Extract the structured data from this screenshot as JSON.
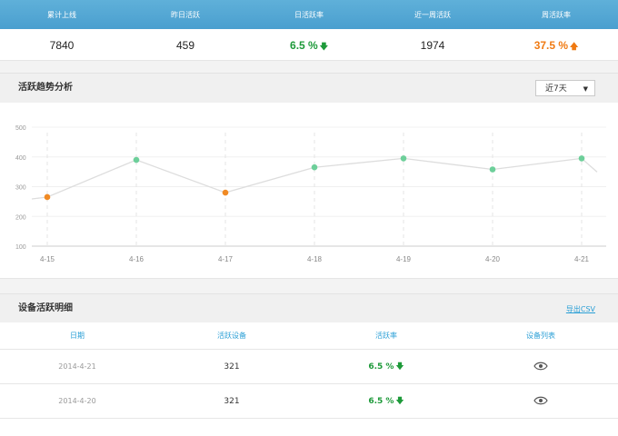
{
  "stats": {
    "headers": [
      "累计上线",
      "昨日活跃",
      "日活跃率",
      "近一周活跃",
      "周活跃率"
    ],
    "values": {
      "total": "7840",
      "yesterday": "459",
      "daily_rate": "6.5 %",
      "week_active": "1974",
      "weekly_rate": "37.5 %"
    },
    "daily_trend": "down",
    "weekly_trend": "up"
  },
  "trend": {
    "title": "活跃趋势分析",
    "range_select": "近7天"
  },
  "chart_data": {
    "type": "line",
    "title": "",
    "xlabel": "",
    "ylabel": "",
    "categories": [
      "4-15",
      "4-16",
      "4-17",
      "4-18",
      "4-19",
      "4-20",
      "4-21"
    ],
    "values": [
      265,
      390,
      280,
      365,
      395,
      358,
      395
    ],
    "point_colors": [
      "#f08a24",
      "#6dcf9a",
      "#f08a24",
      "#6dcf9a",
      "#6dcf9a",
      "#6dcf9a",
      "#6dcf9a"
    ],
    "y_ticks": [
      "500",
      "400",
      "300",
      "200",
      "100"
    ],
    "ylim": [
      100,
      500
    ],
    "grid": true,
    "line_color": "#dddddd"
  },
  "detail": {
    "title": "设备活跃明细",
    "export_label": "导出CSV",
    "columns": [
      "日期",
      "活跃设备",
      "活跃率",
      "设备列表"
    ],
    "rows": [
      {
        "date": "2014-4-21",
        "devices": "321",
        "rate": "6.5 %"
      },
      {
        "date": "2014-4-20",
        "devices": "321",
        "rate": "6.5 %"
      }
    ]
  },
  "colors": {
    "header_bg": "#4fa6d4",
    "green": "#1e9a3a",
    "orange": "#f07a12",
    "link": "#2a9fd6"
  }
}
